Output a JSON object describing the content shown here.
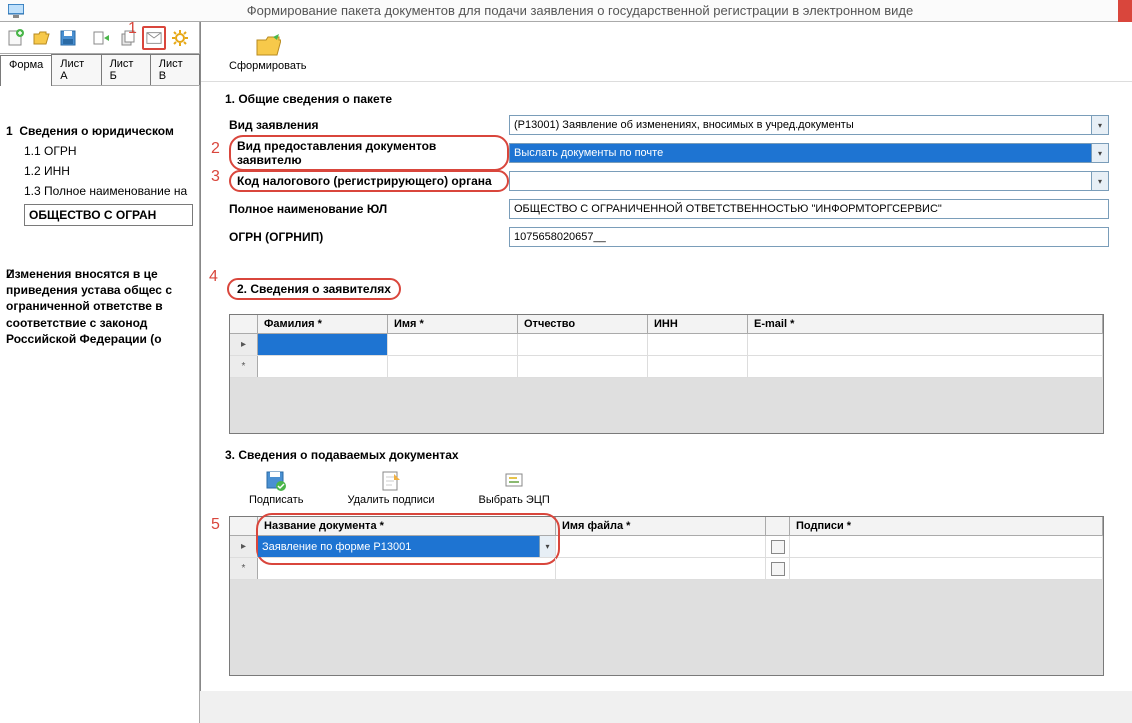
{
  "title": "Формирование пакета документов для подачи заявления о государственной регистрации в электронном виде",
  "annotations": {
    "a1": "1",
    "a2": "2",
    "a3": "3",
    "a4": "4",
    "a5": "5"
  },
  "tabs": {
    "forma": "Форма",
    "listA": "Лист А",
    "listB": "Лист Б",
    "listV": "Лист В"
  },
  "mainToolbar": {
    "form": "Сформировать"
  },
  "left": {
    "l1_num": "1",
    "l1": "Сведения о юридическом",
    "l11": "1.1  ОГРН",
    "l12": "1.2  ИНН",
    "l13": "1.3  Полное наименование на",
    "l13v": "ОБЩЕСТВО  С  ОГРАН",
    "para_num": "2",
    "para": "Изменения вносятся в це приведения устава общес с ограниченной ответстве в соответствие с законод Российской Федерации (о"
  },
  "section1": {
    "title": "1. Общие сведения о пакете",
    "vid_zayav_label": "Вид заявления",
    "vid_zayav_value": "(Р13001) Заявление об изменениях, вносимых в учред.документы",
    "vid_pred_label": "Вид предоставления документов заявителю",
    "vid_pred_value": "Выслать документы по почте",
    "kod_label": "Код налогового (регистрирующего) органа",
    "kod_value": "",
    "polnoe_label": "Полное наименование ЮЛ",
    "polnoe_value": "ОБЩЕСТВО С ОГРАНИЧЕННОЙ ОТВЕТСТВЕННОСТЬЮ \"ИНФОРМТОРГСЕРВИС\"",
    "ogrn_label": "ОГРН (ОГРНИП)",
    "ogrn_value": "1075658020657__"
  },
  "section2": {
    "title": "2. Сведения о заявителях",
    "hdr": {
      "fam": "Фамилия *",
      "imya": "Имя *",
      "otch": "Отчество",
      "inn": "ИНН",
      "email": "E-mail *"
    }
  },
  "section3": {
    "title": "3. Сведения о подаваемых документах",
    "tb": {
      "sign": "Подписать",
      "unsign": "Удалить подписи",
      "ecp": "Выбрать ЭЦП"
    },
    "hdr": {
      "name": "Название документа *",
      "file": "Имя файла *",
      "sig": "Подписи *"
    },
    "row1_name": "Заявление по форме Р13001"
  }
}
